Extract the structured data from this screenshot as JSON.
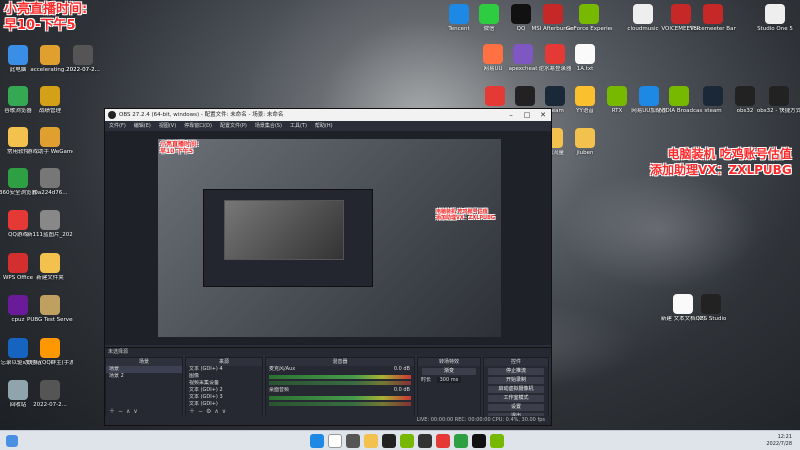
{
  "overlay": {
    "stream_time_line1": "小亮直播时间:",
    "stream_time_line2": "早10-下午5",
    "ad_line1": "电脑装机 吃鸡账号估值",
    "ad_line2": "添加助理VX：ZXLPUBG"
  },
  "desktop_icons_left": [
    {
      "label": "此电脑",
      "icon": "computer-icon",
      "color": "#3a8ee6"
    },
    {
      "label": "accelerating...",
      "icon": "app-icon",
      "color": "#e0a030"
    },
    {
      "label": "2022-07-2...",
      "icon": "file-icon",
      "color": "#555"
    },
    {
      "label": "谷歌浏览器",
      "icon": "chrome-icon",
      "color": "#34a853"
    },
    {
      "label": "战绩管理",
      "icon": "app-icon",
      "color": "#d4a017"
    },
    {
      "label": "2022-07-2...",
      "icon": "file-icon",
      "color": "#555"
    },
    {
      "label": "常用软件",
      "icon": "folder-icon",
      "color": "#f2c14e"
    },
    {
      "label": "游戏助手 WeGame版",
      "icon": "wegame-icon",
      "color": "#e0a030"
    },
    {
      "label": "360安全浏览器",
      "icon": "browser-icon",
      "color": "#2ea043"
    },
    {
      "label": "f0a224d76...",
      "icon": "file-icon",
      "color": "#777"
    },
    {
      "label": "QQ游戏",
      "icon": "qq-game-icon",
      "color": "#e53935"
    },
    {
      "label": "新111蓝图片_2022042...",
      "icon": "image-icon",
      "color": "#888"
    },
    {
      "label": "WPS Office",
      "icon": "wps-icon",
      "color": "#d32f2f"
    },
    {
      "label": "新建文件夹",
      "icon": "folder-icon",
      "color": "#f2c14e"
    },
    {
      "label": "cpuz",
      "icon": "cpuz-icon",
      "color": "#6a1b9a"
    },
    {
      "label": "PUBG Test Server",
      "icon": "pubg-icon",
      "color": "#c0a060"
    },
    {
      "label": "备忘录以驱动(包括打印)",
      "icon": "doc-icon",
      "color": "#1565c0"
    },
    {
      "label": "联系:(QQ群主(手游电脑版))",
      "icon": "app-icon",
      "color": "#ff9800"
    },
    {
      "label": "回收站",
      "icon": "recycle-bin-icon",
      "color": "#90a4ae"
    },
    {
      "label": "2022-07-2...",
      "icon": "file-icon",
      "color": "#555"
    }
  ],
  "desktop_icons_top": [
    {
      "label": "Tencent",
      "icon": "tencent-icon",
      "color": "#1e88e5"
    },
    {
      "label": "微信",
      "icon": "wechat-icon",
      "color": "#2ecc40"
    },
    {
      "label": "QQ",
      "icon": "qq-icon",
      "color": "#111"
    },
    {
      "label": "MSI Afterburner",
      "icon": "msi-icon",
      "color": "#c62828"
    },
    {
      "label": "GeForce Experience",
      "icon": "nvidia-icon",
      "color": "#76b900"
    },
    {
      "label": "cloudmusic",
      "icon": "app-icon",
      "color": "#eee"
    },
    {
      "label": "VOICEMEETER",
      "icon": "voicemeeter-icon",
      "color": "#c62828"
    },
    {
      "label": "Voicemeeter Banana",
      "icon": "voicemeeter-icon",
      "color": "#c62828"
    },
    {
      "label": "Studio One 5",
      "icon": "studio-one-icon",
      "color": "#eee"
    }
  ],
  "desktop_icons_mid": [
    {
      "label": "网易UU",
      "icon": "app-icon",
      "color": "#ff7043"
    },
    {
      "label": "apexcheat",
      "icon": "app-icon",
      "color": "#7e57c2"
    },
    {
      "label": "逆水寒登录器",
      "icon": "app-icon",
      "color": "#e53935"
    },
    {
      "label": "1A.txt",
      "icon": "txt-icon",
      "color": "#fafafa"
    },
    {
      "label": "网易云音乐",
      "icon": "netease-icon",
      "color": "#e53935"
    },
    {
      "label": "OBS",
      "icon": "obs-icon",
      "color": "#222"
    },
    {
      "label": "Steam",
      "icon": "steam-icon",
      "color": "#1b2838"
    },
    {
      "label": "YY语音",
      "icon": "yy-icon",
      "color": "#fbc02d"
    },
    {
      "label": "RTX",
      "icon": "app-icon",
      "color": "#76b900"
    },
    {
      "label": "网易UU加速器",
      "icon": "app-icon",
      "color": "#1e88e5"
    },
    {
      "label": "NVIDIA Broadcast",
      "icon": "nvidia-icon",
      "color": "#76b900"
    },
    {
      "label": "steam",
      "icon": "steam-icon",
      "color": "#1b2838"
    },
    {
      "label": "obs32",
      "icon": "obs-icon",
      "color": "#222"
    },
    {
      "label": "obs32 - 快捷方式",
      "icon": "obs-icon",
      "color": "#222"
    },
    {
      "label": "直播流量",
      "icon": "folder-icon",
      "color": "#f2c14e"
    },
    {
      "label": "jiuben",
      "icon": "folder-icon",
      "color": "#f2c14e"
    }
  ],
  "desktop_icons_right": [
    {
      "label": "新建 文本文档 (2)",
      "icon": "txt-icon",
      "color": "#fafafa"
    },
    {
      "label": "OBS Studio",
      "icon": "obs-icon",
      "color": "#222"
    }
  ],
  "obs": {
    "title": "OBS 27.2.4 (64-bit, windows) - 配置文件: 未命名 - 场景: 未命名",
    "menu": [
      "文件(F)",
      "编辑(E)",
      "视图(V)",
      "停靠窗口(D)",
      "配置文件(P)",
      "场景集合(S)",
      "工具(T)",
      "帮助(H)"
    ],
    "scene_bar_label": "未选择源",
    "docks": {
      "scenes_header": "场景",
      "scenes": [
        "场景",
        "场景 2"
      ],
      "sources_header": "来源",
      "sources": [
        "文本 (GDI+) 4",
        "图像",
        "视频采集设备",
        "文本 (GDI+) 2",
        "文本 (GDI+) 3",
        "文本 (GDI+)"
      ],
      "mixer_header": "混音器",
      "mixer_tracks": [
        "麦克风/Aux",
        "桌面音频"
      ],
      "mixer_levels": [
        "0.0 dB",
        "0.0 dB"
      ],
      "transitions_header": "转场特效",
      "transition_value": "渐变",
      "duration_label": "时长",
      "duration_value": "300 ms",
      "controls_header": "控件",
      "controls": [
        "停止推流",
        "开始录制",
        "启动虚拟摄像机",
        "工作室模式",
        "设置",
        "退出"
      ]
    },
    "status": "LIVE: 00:00:00   REC: 00:00:00   CPU: 0.4%, 30.00 fps"
  },
  "taskbar": {
    "time": "12:21",
    "date": "2022/7/28"
  }
}
